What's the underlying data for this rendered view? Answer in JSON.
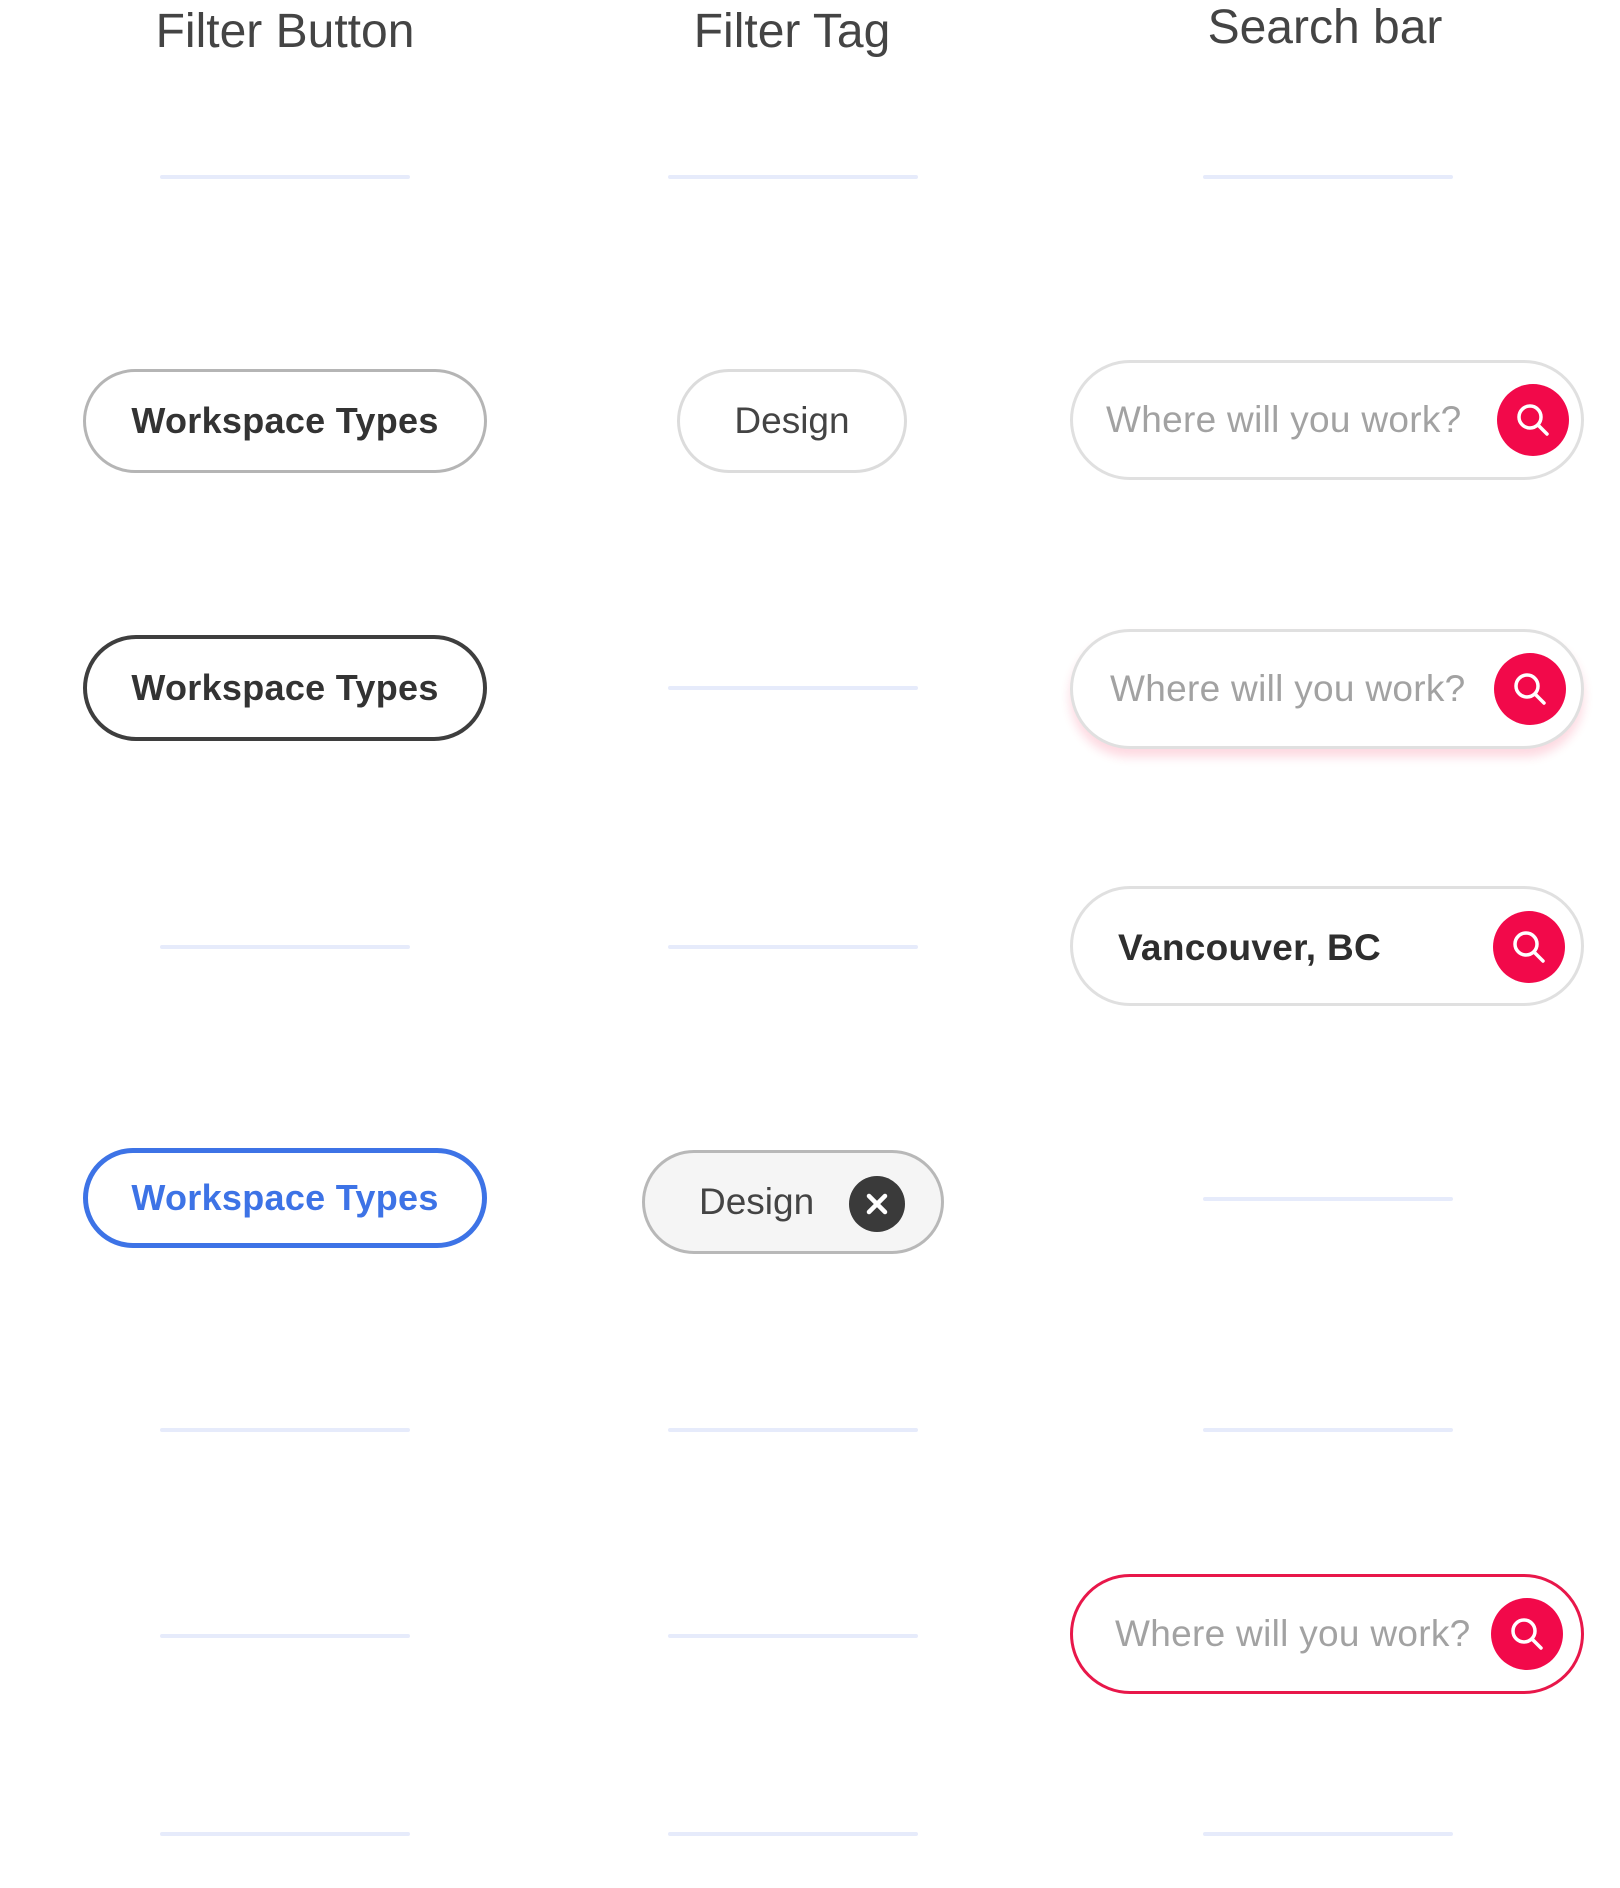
{
  "columns": {
    "filter_button": {
      "title": "Filter Button"
    },
    "filter_tag": {
      "title": "Filter Tag"
    },
    "search_bar": {
      "title": "Search bar"
    }
  },
  "filter_buttons": [
    {
      "state": "default",
      "label": "Workspace Types"
    },
    {
      "state": "hover",
      "label": "Workspace Types"
    },
    {
      "state": "active",
      "label": "Workspace Types"
    }
  ],
  "filter_tags": [
    {
      "state": "default",
      "label": "Design"
    },
    {
      "state": "selected",
      "label": "Design",
      "icon": "close-icon"
    }
  ],
  "search_bars": [
    {
      "state": "default",
      "placeholder": "Where will you work?",
      "icon": "search-icon"
    },
    {
      "state": "hover",
      "placeholder": "Where will you work?",
      "icon": "search-icon"
    },
    {
      "state": "filled",
      "value": "Vancouver, BC",
      "icon": "search-icon"
    },
    {
      "state": "error",
      "placeholder": "Where will you work?",
      "icon": "search-icon"
    }
  ],
  "colors": {
    "brand_red": "#f2094a",
    "active_blue": "#3d73e6",
    "divider": "#e6ebfb",
    "text_dark": "#333333",
    "placeholder": "#a2a2a2"
  }
}
